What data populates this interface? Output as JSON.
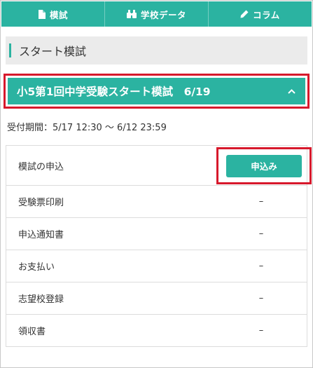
{
  "nav": {
    "items": [
      {
        "label": "模試",
        "icon": "document-icon"
      },
      {
        "label": "学校データ",
        "icon": "binoculars-icon"
      },
      {
        "label": "コラム",
        "icon": "pencil-icon"
      }
    ]
  },
  "section": {
    "title": "スタート模試"
  },
  "exam": {
    "title": "小5第1回中学受験スタート模試　6/19",
    "period": "受付期間：5/17  12:30 ～ 6/12  23:59"
  },
  "rows": [
    {
      "label": "模試の申込",
      "button": "申込み"
    },
    {
      "label": "受験票印刷",
      "status": "–"
    },
    {
      "label": "申込通知書",
      "status": "–"
    },
    {
      "label": "お支払い",
      "status": "–"
    },
    {
      "label": "志望校登録",
      "status": "–"
    },
    {
      "label": "領収書",
      "status": "–"
    }
  ],
  "colors": {
    "accent": "#2bb3a1",
    "highlight": "#d7192c"
  }
}
